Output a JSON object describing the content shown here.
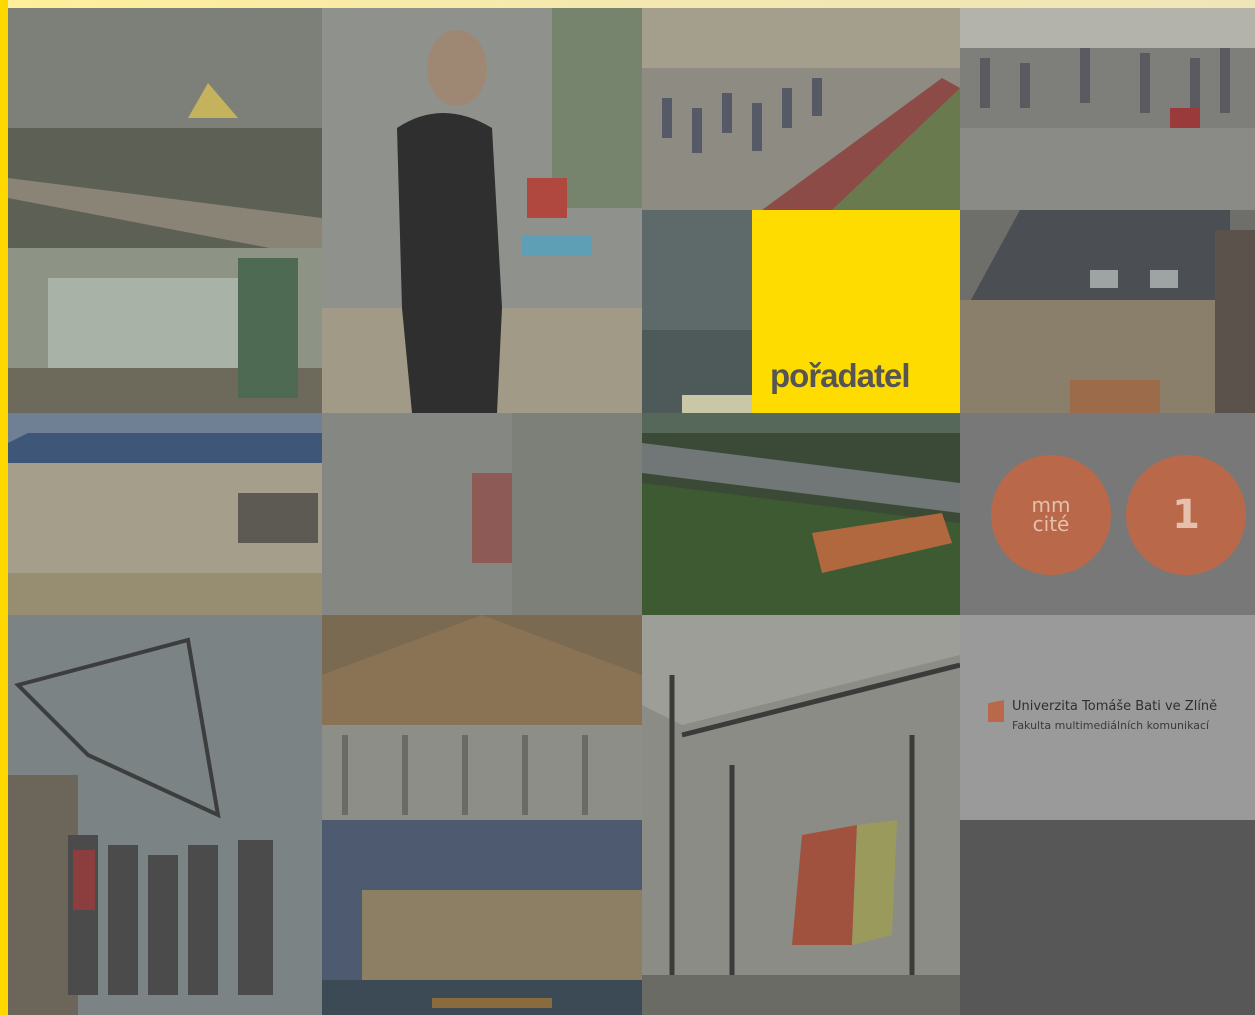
{
  "accent_yellow": "#ffdc00",
  "label": {
    "text": "pořadatel"
  },
  "logo": {
    "circle1": "mm\ncité",
    "circle2": "1",
    "color": "#b9694a"
  },
  "university": {
    "line1": "Univerzita Tomáše Bati ve Zlíně",
    "line2": "Fakulta multimediálních komunikací"
  },
  "photos": [
    {
      "name": "photo-interior-roof"
    },
    {
      "name": "photo-man-presenting"
    },
    {
      "name": "photo-crowd-square"
    },
    {
      "name": "photo-crowd-street"
    },
    {
      "name": "photo-night-building"
    },
    {
      "name": "photo-wooden-houses"
    },
    {
      "name": "photo-blue-roof-building"
    },
    {
      "name": "photo-painted-wall"
    },
    {
      "name": "photo-park-bench"
    },
    {
      "name": "photo-grid-structure-people"
    },
    {
      "name": "photo-timber-ceiling"
    },
    {
      "name": "photo-glass-pavilion"
    },
    {
      "name": "photo-steel-canopy"
    }
  ]
}
